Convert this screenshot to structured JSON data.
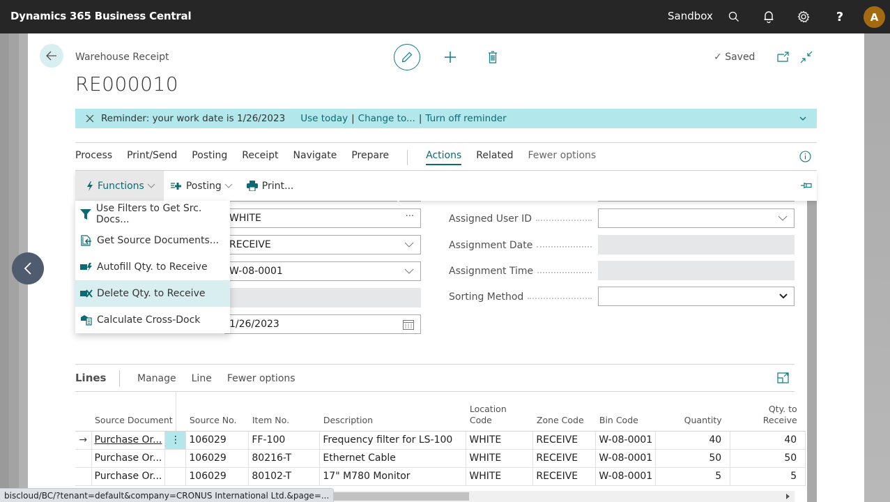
{
  "topbar": {
    "app_title": "Dynamics 365 Business Central",
    "environment": "Sandbox",
    "avatar_initial": "A",
    "icons": [
      "search-icon",
      "bell-icon",
      "gear-icon",
      "help-icon"
    ],
    "help_label": "?"
  },
  "header": {
    "breadcrumb": "Warehouse Receipt",
    "title": "RE000010",
    "saved_label": "Saved"
  },
  "reminder": {
    "message": "Reminder: your work date is 1/26/2023",
    "links": [
      "Use today",
      "Change to...",
      "Turn off reminder"
    ],
    "separator": "|"
  },
  "action_tabs": {
    "items": [
      "Process",
      "Print/Send",
      "Posting",
      "Receipt",
      "Navigate",
      "Prepare"
    ],
    "secondary": [
      "Actions",
      "Related",
      "Fewer options"
    ],
    "active": "Actions"
  },
  "subbar": {
    "functions": "Functions",
    "posting": "Posting",
    "print": "Print..."
  },
  "functions_menu": {
    "items": [
      {
        "label": "Use Filters to Get Src. Docs...",
        "icon": "filter-icon"
      },
      {
        "label": "Get Source Documents...",
        "icon": "get-source-icon"
      },
      {
        "label": "Autofill Qty. to Receive",
        "icon": "autofill-icon"
      },
      {
        "label": "Delete Qty. to Receive",
        "icon": "delete-qty-icon"
      },
      {
        "label": "Calculate Cross-Dock",
        "icon": "cross-dock-icon"
      }
    ],
    "hovered_index": 3
  },
  "form": {
    "left_fields": [
      {
        "value": "WHITE",
        "control": "lookup",
        "lookup_label": "···"
      },
      {
        "value": "RECEIVE",
        "control": "dropdown"
      },
      {
        "value": "W-08-0001",
        "control": "dropdown"
      },
      {
        "value": "",
        "control": "readonly"
      },
      {
        "value": "1/26/2023",
        "control": "date"
      }
    ],
    "right_fields": [
      {
        "label": "Assigned User ID",
        "value": "",
        "control": "dropdown"
      },
      {
        "label": "Assignment Date",
        "value": "",
        "control": "readonly"
      },
      {
        "label": "Assignment Time",
        "value": "",
        "control": "readonly"
      },
      {
        "label": "Sorting Method",
        "value": "",
        "control": "select"
      }
    ]
  },
  "lines": {
    "title": "Lines",
    "actions": [
      "Manage",
      "Line",
      "Fewer options"
    ],
    "columns": [
      "Source Document",
      "Source No.",
      "Item No.",
      "Description",
      "Location Code",
      "Zone Code",
      "Bin Code",
      "Quantity",
      "Qty. to Receive"
    ],
    "rows": [
      {
        "source_document": "Purchase Or...",
        "source_no": "106029",
        "item_no": "FF-100",
        "description": "Frequency filter for LS-100",
        "location_code": "WHITE",
        "zone_code": "RECEIVE",
        "bin_code": "W-08-0001",
        "quantity": "40",
        "qty_to_receive": "40",
        "selected": true
      },
      {
        "source_document": "Purchase Or...",
        "source_no": "106029",
        "item_no": "80216-T",
        "description": "Ethernet Cable",
        "location_code": "WHITE",
        "zone_code": "RECEIVE",
        "bin_code": "W-08-0001",
        "quantity": "50",
        "qty_to_receive": "50",
        "selected": false
      },
      {
        "source_document": "Purchase Or...",
        "source_no": "106029",
        "item_no": "80102-T",
        "description": "17\" M780 Monitor",
        "location_code": "WHITE",
        "zone_code": "RECEIVE",
        "bin_code": "W-08-0001",
        "quantity": "5",
        "qty_to_receive": "5",
        "selected": false
      }
    ],
    "row_indicator": "→",
    "row_menu": "⋮"
  },
  "status_bar": {
    "url": "biscloud/BC/?tenant=default&company=CRONUS International Ltd.&page=..."
  },
  "colors": {
    "accent": "#0b6a73",
    "topbar": "#262626",
    "reminder_bg": "#b2e7ec",
    "avatar": "#a46a10",
    "hover": "#d9eef1"
  }
}
